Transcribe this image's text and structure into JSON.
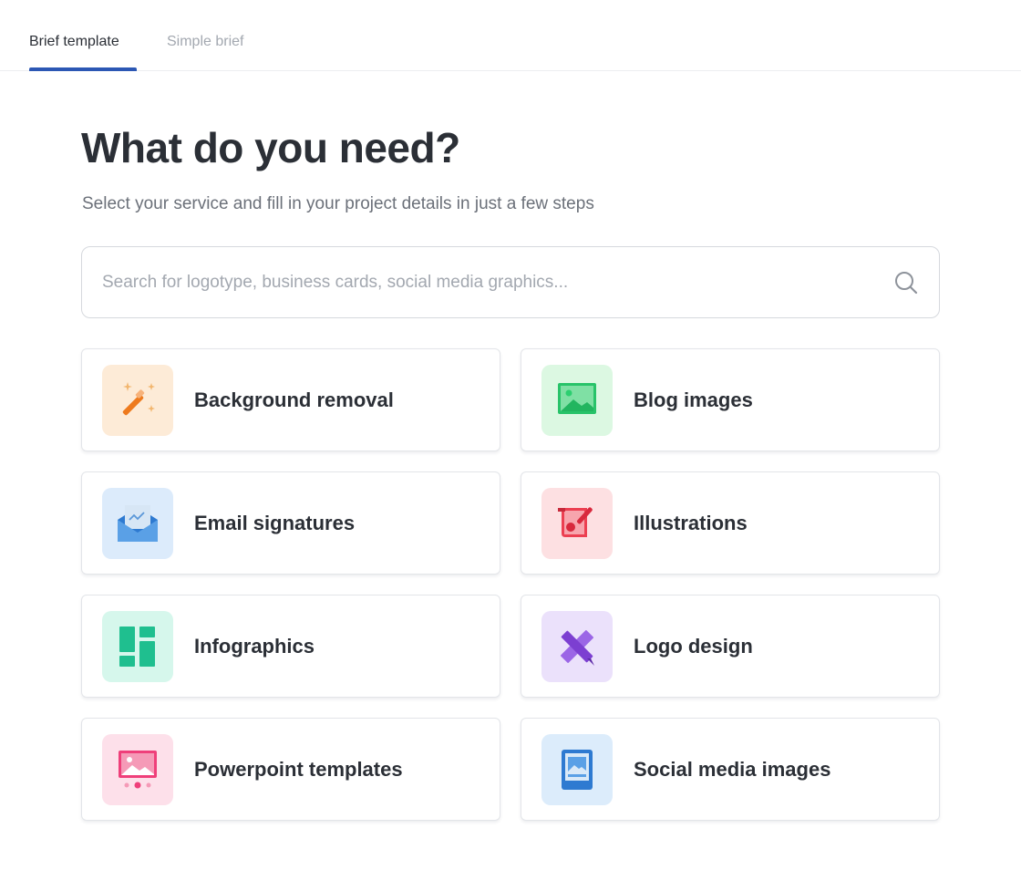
{
  "tabs": [
    {
      "label": "Brief template",
      "active": true
    },
    {
      "label": "Simple brief",
      "active": false
    }
  ],
  "header": {
    "title": "What do you need?",
    "subtitle": "Select your service and fill in your project details in just a few steps"
  },
  "search": {
    "value": "",
    "placeholder": "Search for logotype, business cards, social media graphics..."
  },
  "services": [
    {
      "label": "Background removal",
      "icon": "magic-wand-icon",
      "bg": "#fdebd7"
    },
    {
      "label": "Blog images",
      "icon": "image-icon",
      "bg": "#dcf8e2"
    },
    {
      "label": "Email signatures",
      "icon": "envelope-icon",
      "bg": "#dcebfb"
    },
    {
      "label": "Illustrations",
      "icon": "illustration-brush-icon",
      "bg": "#fde0e2"
    },
    {
      "label": "Infographics",
      "icon": "layout-blocks-icon",
      "bg": "#d6f7ec"
    },
    {
      "label": "Logo design",
      "icon": "ruler-pencil-icon",
      "bg": "#ebe1fb"
    },
    {
      "label": "Powerpoint templates",
      "icon": "presentation-icon",
      "bg": "#fde0ea"
    },
    {
      "label": "Social media images",
      "icon": "phone-photo-icon",
      "bg": "#dcecfb"
    }
  ],
  "colors": {
    "accent": "#2c57b4",
    "text": "#2b2f36",
    "muted": "#a3a8b0"
  }
}
